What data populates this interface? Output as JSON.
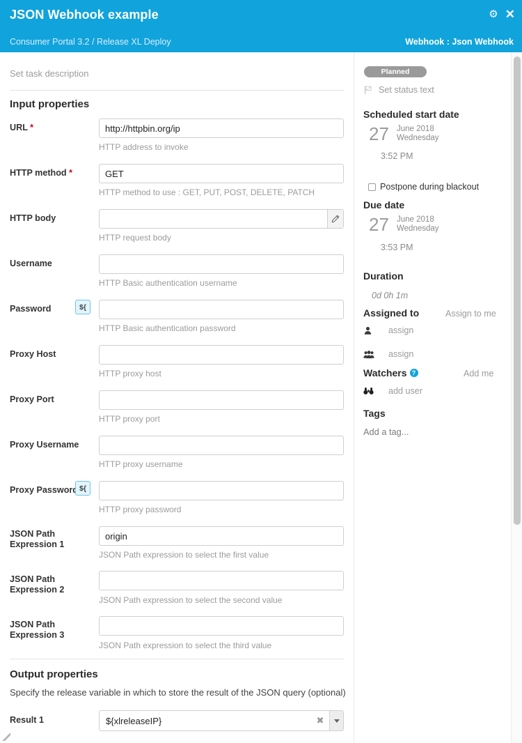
{
  "header": {
    "title": "JSON Webhook example",
    "breadcrumb": "Consumer Portal 3.2 / Release XL Deploy",
    "right_label": "Webhook : Json Webhook",
    "gear_icon": "gear-icon",
    "close_icon": "close-icon",
    "background_color": "#11a3dc"
  },
  "form": {
    "task_description_placeholder": "Set task description",
    "input_section_title": "Input properties",
    "output_section_title": "Output properties",
    "output_section_subtitle": "Specify the release variable in which to store the result of the JSON query (optional)",
    "required_marker": "*",
    "variable_button_label": "${",
    "edit_icon": "pencil-icon",
    "fields": [
      {
        "label": "URL",
        "required": true,
        "value": "http://httpbin.org/ip",
        "placeholder": "",
        "help": "HTTP address to invoke"
      },
      {
        "label": "HTTP method",
        "required": true,
        "value": "GET",
        "placeholder": "",
        "help": "HTTP method to use : GET, PUT, POST, DELETE, PATCH"
      },
      {
        "label": "HTTP body",
        "required": false,
        "value": "",
        "placeholder": "",
        "help": "HTTP request body"
      },
      {
        "label": "Username",
        "required": false,
        "value": "",
        "placeholder": "",
        "help": "HTTP Basic authentication username"
      },
      {
        "label": "Password",
        "required": false,
        "value": "",
        "placeholder": "",
        "help": "HTTP Basic authentication password"
      },
      {
        "label": "Proxy Host",
        "required": false,
        "value": "",
        "placeholder": "",
        "help": "HTTP proxy host"
      },
      {
        "label": "Proxy Port",
        "required": false,
        "value": "",
        "placeholder": "",
        "help": "HTTP proxy port"
      },
      {
        "label": "Proxy Username",
        "required": false,
        "value": "",
        "placeholder": "",
        "help": "HTTP proxy username"
      },
      {
        "label": "Proxy Password",
        "required": false,
        "value": "",
        "placeholder": "",
        "help": "HTTP proxy password"
      },
      {
        "label": "JSON Path Expression 1",
        "required": false,
        "value": "origin",
        "placeholder": "",
        "help": "JSON Path expression to select the first value"
      },
      {
        "label": "JSON Path Expression 2",
        "required": false,
        "value": "",
        "placeholder": "",
        "help": "JSON Path expression to select the second value"
      },
      {
        "label": "JSON Path Expression 3",
        "required": false,
        "value": "",
        "placeholder": "",
        "help": "JSON Path expression to select the third value"
      }
    ],
    "result": {
      "label": "Result 1",
      "value": "${xlreleaseIP}",
      "clear_icon": "clear-icon",
      "caret_icon": "chevron-down-icon"
    }
  },
  "sidebar": {
    "status_badge": "Planned",
    "status_badge_color": "#9a9a9a",
    "status_text": "Set status text",
    "status_icon": "flag-icon",
    "scheduled": {
      "heading": "Scheduled start date",
      "day": "27",
      "month_year": "June 2018",
      "weekday": "Wednesday",
      "time": "3:52 PM"
    },
    "postpone": {
      "label": "Postpone during blackout",
      "checked": false
    },
    "due": {
      "heading": "Due date",
      "day": "27",
      "month_year": "June 2018",
      "weekday": "Wednesday",
      "time": "3:53 PM"
    },
    "duration": {
      "heading": "Duration",
      "value": "0d 0h 1m"
    },
    "assigned": {
      "heading": "Assigned to",
      "action": "Assign to me",
      "user_row": {
        "icon": "user-icon",
        "text": "assign"
      },
      "team_row": {
        "icon": "users-group-icon",
        "text": "assign"
      }
    },
    "watchers": {
      "heading": "Watchers",
      "help_icon": "help-circle-icon",
      "help_glyph": "?",
      "action": "Add me",
      "row": {
        "icon": "binoculars-icon",
        "text": "add user"
      }
    },
    "tags": {
      "heading": "Tags",
      "add_placeholder": "Add a tag..."
    }
  },
  "scrollbar": {
    "name": "vertical-scrollbar"
  }
}
